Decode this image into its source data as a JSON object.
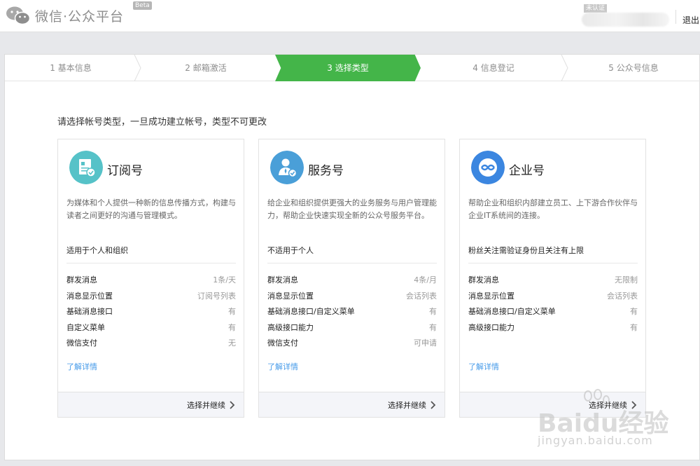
{
  "header": {
    "logo_text": "微信·公众平台",
    "beta": "Beta",
    "unverified": "未认证",
    "logout": "退出"
  },
  "steps": [
    {
      "label": "1 基本信息",
      "active": false
    },
    {
      "label": "2 邮箱激活",
      "active": false
    },
    {
      "label": "3 选择类型",
      "active": true
    },
    {
      "label": "4 信息登记",
      "active": false
    },
    {
      "label": "5 公众号信息",
      "active": false
    }
  ],
  "intro": "请选择帐号类型，一旦成功建立帐号，类型不可更改",
  "cards": [
    {
      "title": "订阅号",
      "icon": "subscription-doc-icon",
      "icon_color": "#56c2c8",
      "desc": "为媒体和个人提供一种新的信息传播方式，构建与读者之间更好的沟通与管理模式。",
      "scope": "适用于个人和组织",
      "features": [
        {
          "name": "群发消息",
          "value": "1条/天"
        },
        {
          "name": "消息显示位置",
          "value": "订阅号列表"
        },
        {
          "name": "基础消息接口",
          "value": "有"
        },
        {
          "name": "自定义菜单",
          "value": "有"
        },
        {
          "name": "微信支付",
          "value": "无"
        }
      ],
      "more": "了解详情",
      "select": "选择并继续"
    },
    {
      "title": "服务号",
      "icon": "service-person-icon",
      "icon_color": "#4a9fd8",
      "desc": "给企业和组织提供更强大的业务服务与用户管理能力，帮助企业快速实现全新的公众号服务平台。",
      "scope": "不适用于个人",
      "features": [
        {
          "name": "群发消息",
          "value": "4条/月"
        },
        {
          "name": "消息显示位置",
          "value": "会话列表"
        },
        {
          "name": "基础消息接口/自定义菜单",
          "value": "有"
        },
        {
          "name": "高级接口能力",
          "value": "有"
        },
        {
          "name": "微信支付",
          "value": "可申请"
        }
      ],
      "more": "了解详情",
      "select": "选择并继续"
    },
    {
      "title": "企业号",
      "icon": "enterprise-link-icon",
      "icon_color": "#3b86e0",
      "desc": "帮助企业和组织内部建立员工、上下游合作伙伴与企业IT系统间的连接。",
      "scope": "粉丝关注需验证身份且关注有上限",
      "features": [
        {
          "name": "群发消息",
          "value": "无限制"
        },
        {
          "name": "消息显示位置",
          "value": "会话列表"
        },
        {
          "name": "基础消息接口/自定义菜单",
          "value": "有"
        },
        {
          "name": "高级接口能力",
          "value": "有"
        }
      ],
      "more": "了解详情",
      "select": "选择并继续"
    }
  ],
  "watermark": {
    "brand": "Baidu经验",
    "url": "jingyan.baidu.com"
  },
  "colors": {
    "accent": "#44b549",
    "link": "#459ae9"
  }
}
